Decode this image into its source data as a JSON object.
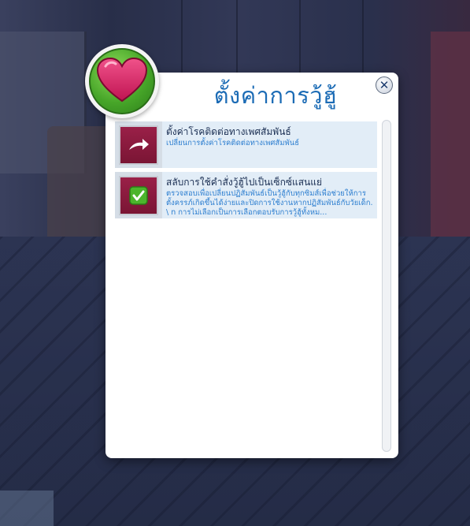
{
  "dialog": {
    "title": "ตั้งค่าการวู้ฮู้",
    "close_icon": "close-icon",
    "badge_icon": "heart-icon"
  },
  "items": [
    {
      "name": "ตั้งค่าโรคติดต่อทางเพศสัมพันธ์",
      "description": "เปลี่ยนการตั้งค่าโรคติดต่อทางเพศสัมพันธ์",
      "icon": "curved-arrow-icon"
    },
    {
      "name": "สลับการใช้คำสั่งวู้ฮู้ไปเป็นเซ็กซ์แสนแย่",
      "description": "ตรวจสอบเพื่อเปลี่ยนปฏิสัมพันธ์เป็นวู้ฮู้กับทุกซิมส์เพื่อช่วยให้การตั้งครรภ์เกิดขึ้นได้ง่ายและปิดการใช้งานหากปฏิสัมพันธ์กับวัยเด็ก. \\ n การไม่เลือกเป็นการเลือกตอบรับการวู้ฮู้ทั้งหม...",
      "icon": "checkmark-icon"
    }
  ],
  "colors": {
    "title": "#1b6bb5",
    "accent_red": "#9a2048",
    "badge_green": "#47a629",
    "item_bg": "#e2edf7"
  }
}
